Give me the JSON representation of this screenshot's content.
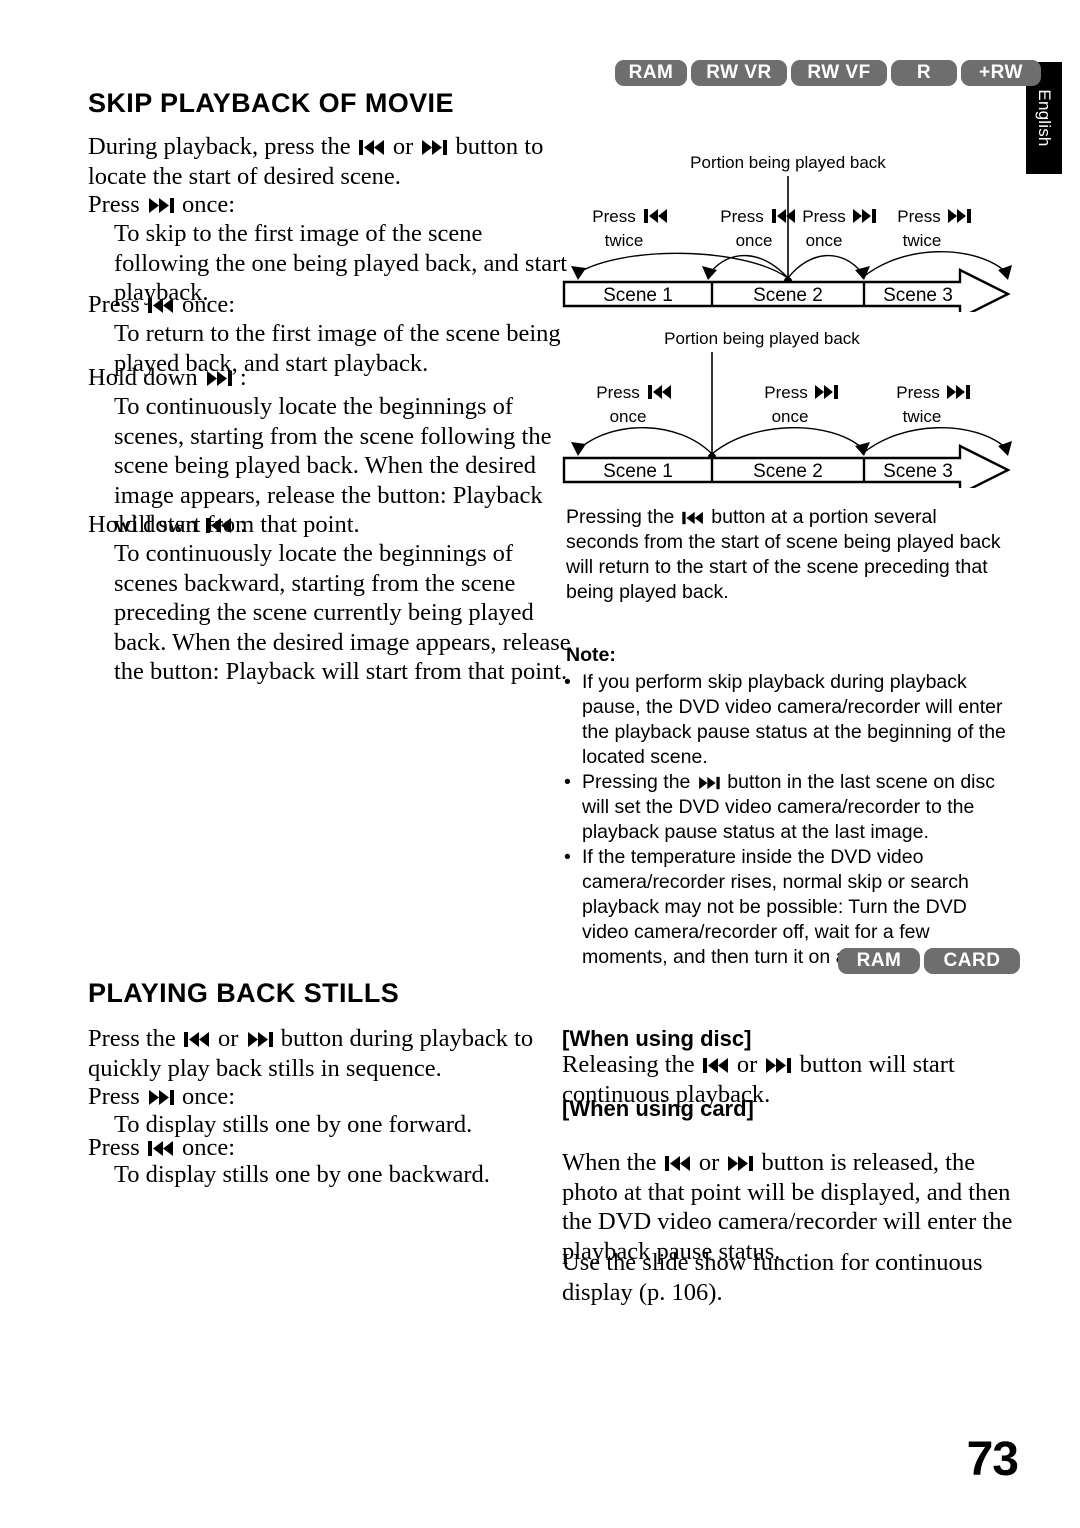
{
  "page": {
    "number": "73",
    "language_tab": "English"
  },
  "badges": {
    "top": [
      "RAM",
      "RW VR",
      "RW VF",
      "R",
      "+RW"
    ],
    "middle": [
      "RAM",
      "CARD"
    ]
  },
  "sections": {
    "skip_playback": {
      "title": "SKIP PLAYBACK OF MOVIE",
      "intro_pre": "During playback, press the",
      "intro_mid": "or",
      "intro_post": "button to locate the start of desired scene.",
      "items": [
        {
          "label_pre": "Press",
          "label_post": "once:",
          "icon": "skip-forward-icon",
          "detail": "To skip to the first image of the scene following the one being played back, and start playback."
        },
        {
          "label_pre": "Press",
          "label_post": "once:",
          "icon": "skip-backward-icon",
          "detail": "To return to the first image of the scene being played back, and start playback."
        },
        {
          "label_pre": "Hold down",
          "label_post": ":",
          "icon": "skip-forward-icon",
          "detail": "To continuously locate the beginnings of scenes, starting from the scene following the scene being played back. When the desired image appears, release the button: Playback will start from that point."
        },
        {
          "label_pre": "Hold down",
          "label_post": ":",
          "icon": "skip-backward-icon",
          "detail": "To continuously locate the beginnings of scenes backward, starting from the scene preceding the scene currently being played back. When the desired image appears, release the button: Playback will start from that point."
        }
      ]
    },
    "playing_back_stills": {
      "title": "PLAYING BACK STILLS",
      "intro_pre": "Press the",
      "intro_mid": "or",
      "intro_post": "button during playback to quickly play back stills in sequence.",
      "items": [
        {
          "label_pre": "Press",
          "label_post": "once:",
          "icon": "skip-forward-icon",
          "detail": "To display stills one by one forward."
        },
        {
          "label_pre": "Press",
          "label_post": "once:",
          "icon": "skip-backward-icon",
          "detail": "To display stills one by one backward."
        }
      ]
    }
  },
  "right_column": {
    "explanation_pre": "Pressing the",
    "explanation_post": "button at a portion several seconds from the start of scene being played back will return to the start of the scene preceding that being played back.",
    "note_label": "Note:",
    "notes": [
      {
        "text": "If you perform skip playback during playback pause, the DVD video camera/recorder will enter the playback pause status at the beginning of the located scene."
      },
      {
        "pre": "Pressing the",
        "icon": "skip-forward-icon",
        "post": "button in the last scene on disc will set the DVD video camera/recorder to the playback pause status at the last image."
      },
      {
        "text": "If the temperature inside the DVD video camera/recorder rises, normal skip or search playback may not be possible: Turn the DVD video camera/recorder off, wait for a few moments, and then turn it on again."
      }
    ],
    "when_using_disc": {
      "heading": "[When using disc]",
      "pre": "Releasing the",
      "mid": "or",
      "post": "button will start continuous playback."
    },
    "when_using_card": {
      "heading": "[When using card]",
      "pre": "When the",
      "mid": "or",
      "post": "button is released, the photo at that point will be displayed, and then the DVD video camera/recorder will enter the playback pause status.",
      "extra": "Use the slide show function for continuous display (p. 106)."
    }
  },
  "diagrams": [
    {
      "caption": "Portion being played back",
      "marker_position": "middle-of-scene-2",
      "scenes": [
        "Scene 1",
        "Scene 2",
        "Scene 3"
      ],
      "press_labels": [
        {
          "pre": "Press",
          "icon": "skip-backward-icon",
          "count": "twice"
        },
        {
          "pre": "Press",
          "icon": "skip-backward-icon",
          "count": "once"
        },
        {
          "pre": "Press",
          "icon": "skip-forward-icon",
          "count": "once"
        },
        {
          "pre": "Press",
          "icon": "skip-forward-icon",
          "count": "twice"
        }
      ]
    },
    {
      "caption": "Portion being played back",
      "marker_position": "start-of-scene-2",
      "scenes": [
        "Scene 1",
        "Scene 2",
        "Scene 3"
      ],
      "press_labels": [
        {
          "pre": "Press",
          "icon": "skip-backward-icon",
          "count": "once"
        },
        {
          "pre": "Press",
          "icon": "skip-forward-icon",
          "count": "once"
        },
        {
          "pre": "Press",
          "icon": "skip-forward-icon",
          "count": "twice"
        }
      ]
    }
  ]
}
